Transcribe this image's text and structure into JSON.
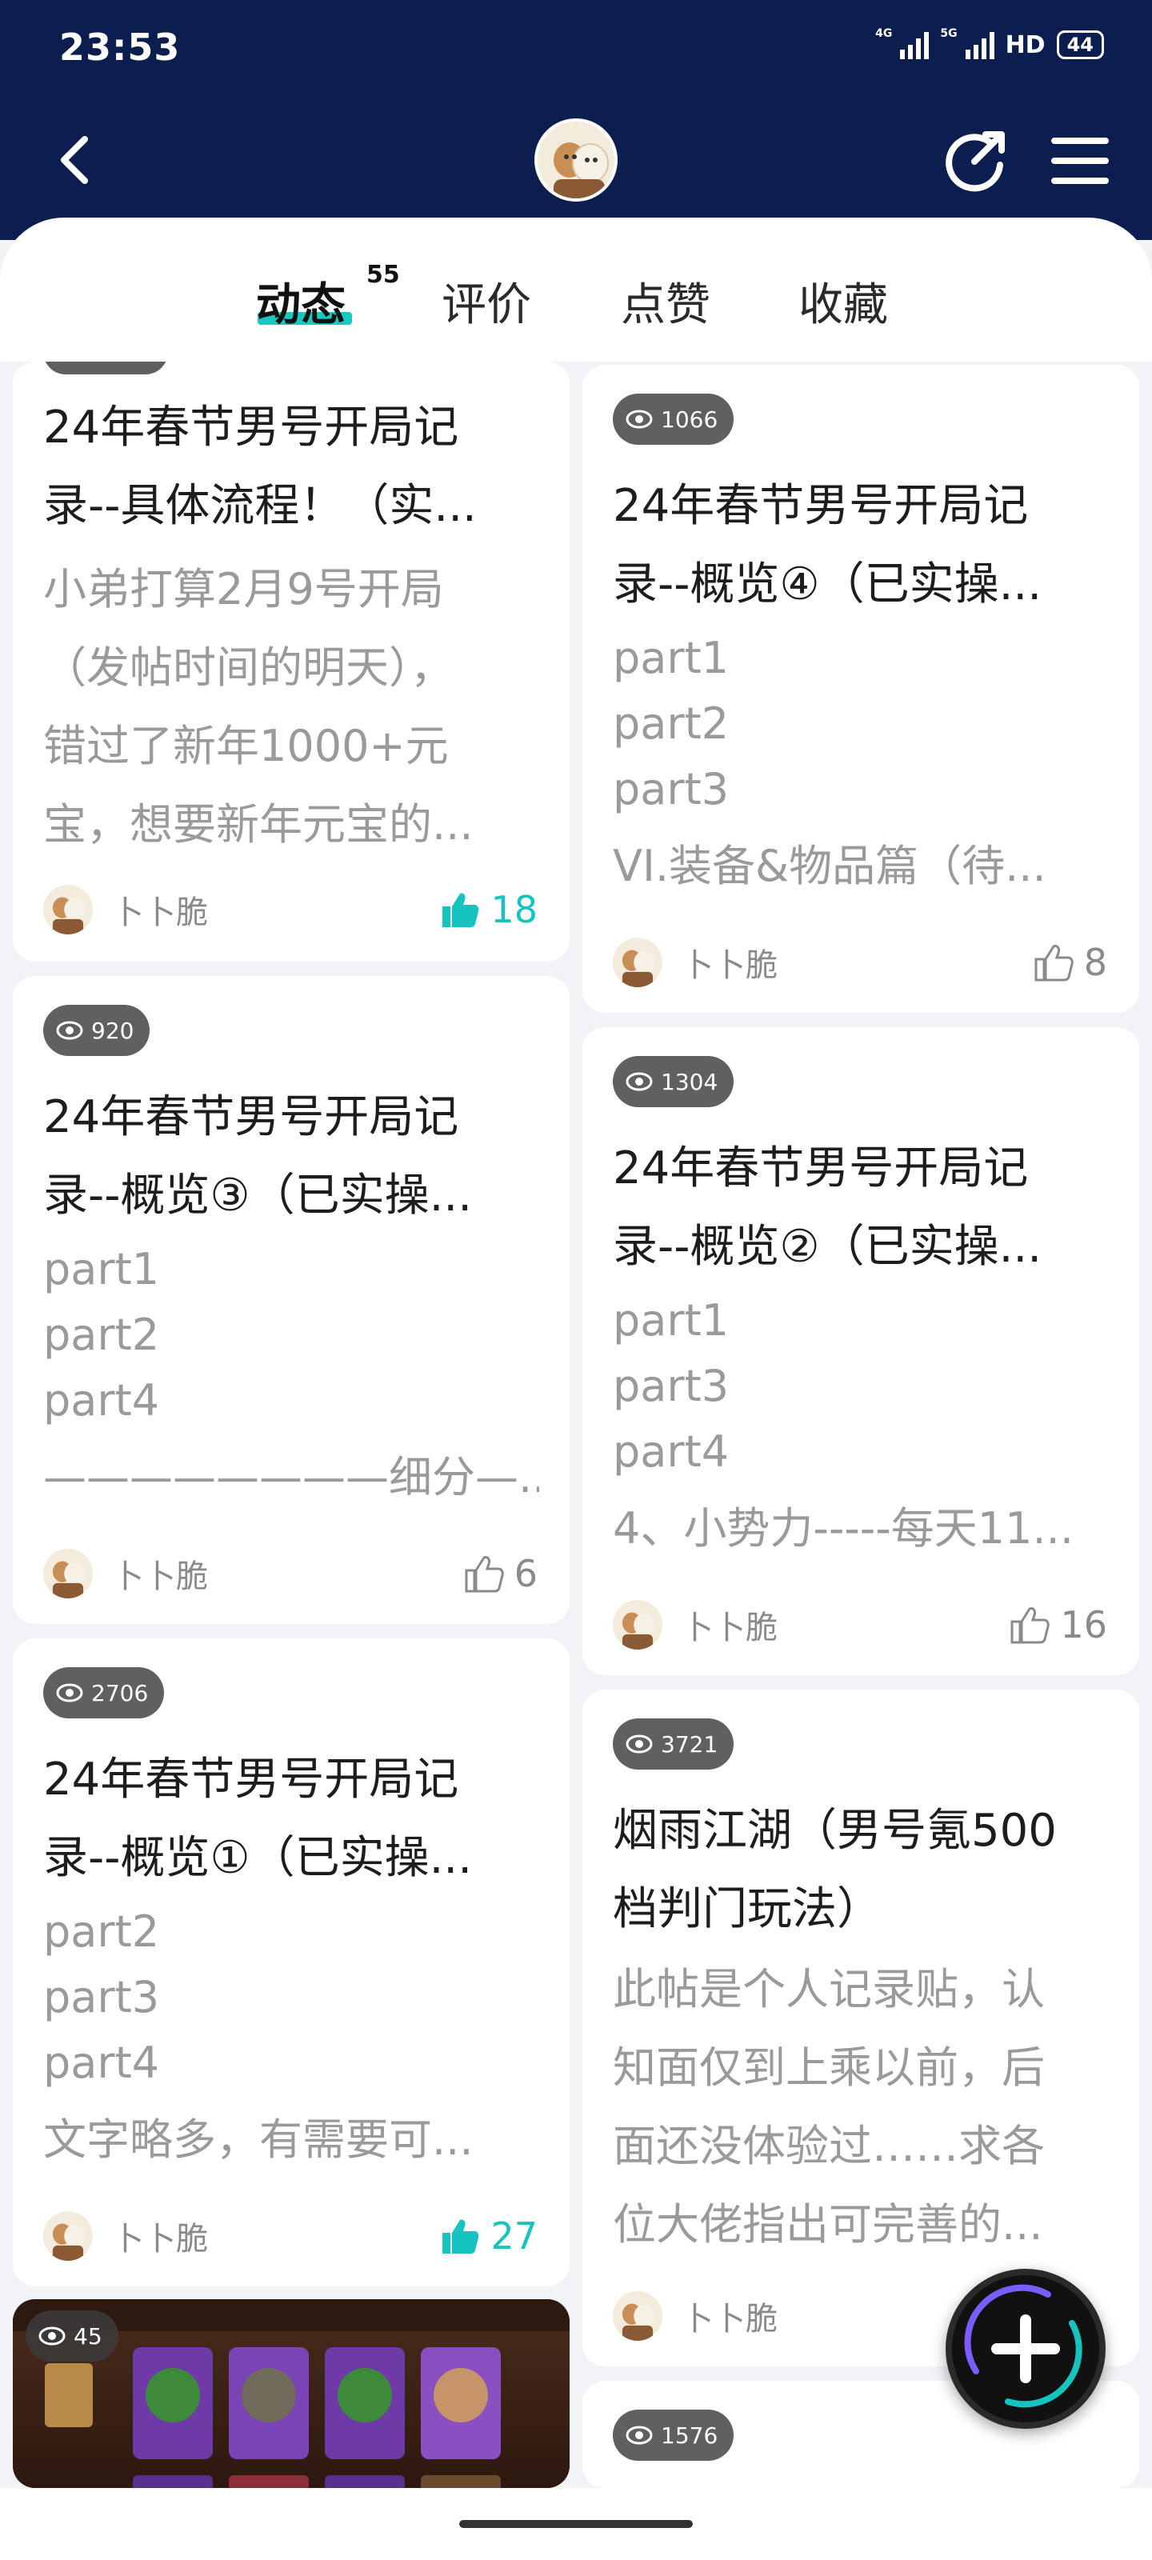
{
  "status_bar": {
    "time": "23:53",
    "network_1": "4G",
    "network_2": "5G",
    "hd": "HD",
    "battery": "44"
  },
  "tabs": [
    {
      "label": "动态",
      "count": "55"
    },
    {
      "label": "评价"
    },
    {
      "label": "点赞"
    },
    {
      "label": "收藏"
    }
  ],
  "posts": [
    {
      "title": [
        "24年春节男号开局记",
        "录--具体流程！（实..."
      ],
      "body": [
        "小弟打算2月9号开局",
        "（发帖时间的明天），",
        "错过了新年1000+元",
        "宝，想要新年元宝的..."
      ],
      "author": "卜卜脆",
      "likes": "18"
    },
    {
      "views": "1066",
      "title": [
        "24年春节男号开局记",
        "录--概览④（已实操..."
      ],
      "body": [
        "part1",
        "part2",
        "part3",
        "VI.装备&物品篇（待..."
      ],
      "author": "卜卜脆",
      "likes": "8"
    },
    {
      "views": "920",
      "title": [
        "24年春节男号开局记",
        "录--概览③（已实操..."
      ],
      "body": [
        "part1",
        "part2",
        "part4",
        "————————细分—..."
      ],
      "author": "卜卜脆",
      "likes": "6"
    },
    {
      "views": "1304",
      "title": [
        "24年春节男号开局记",
        "录--概览②（已实操..."
      ],
      "body": [
        "part1",
        "part3",
        "part4",
        "4、小势力-----每天11..."
      ],
      "author": "卜卜脆",
      "likes": "16"
    },
    {
      "views": "2706",
      "title": [
        "24年春节男号开局记",
        "录--概览①（已实操..."
      ],
      "body": [
        "part2",
        "part3",
        "part4",
        "文字略多，有需要可..."
      ],
      "author": "卜卜脆",
      "likes": "27"
    },
    {
      "views": "3721",
      "title": [
        "烟雨江湖（男号氪500",
        "档判门玩法）"
      ],
      "body": [
        "此帖是个人记录贴，认",
        "知面仅到上乘以前，后",
        "面还没体验过……求各",
        "位大佬指出可完善的..."
      ],
      "author": "卜卜脆"
    },
    {
      "views": "45"
    },
    {
      "views": "1576"
    }
  ],
  "colors": {
    "header": "#0c1d4f",
    "accent": "#16c4bf",
    "background": "#f2f3f6"
  }
}
